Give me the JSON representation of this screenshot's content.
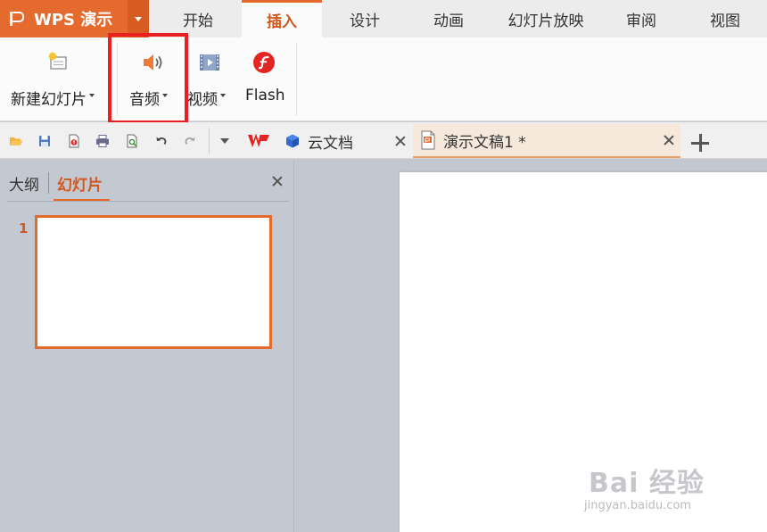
{
  "app": {
    "name": "WPS 演示"
  },
  "tabs": [
    "开始",
    "插入",
    "设计",
    "动画",
    "幻灯片放映",
    "审阅",
    "视图"
  ],
  "active_tab": "插入",
  "ribbon": {
    "new_slide": "新建幻灯片",
    "audio": "音频",
    "video": "视频",
    "flash": "Flash"
  },
  "doc_tabs": {
    "cloud": "云文档",
    "current": "演示文稿1 *"
  },
  "panel": {
    "outline_tab": "大纲",
    "slides_tab": "幻灯片",
    "slide_number": "1"
  },
  "watermark": {
    "main": "Bai 经验",
    "sub": "jingyan.baidu.com"
  },
  "colors": {
    "accent": "#e46a2d",
    "highlight_box": "#e9201f"
  },
  "icons": [
    "new-slide-icon",
    "audio-speaker-icon",
    "video-icon",
    "flash-icon",
    "open-folder-icon",
    "save-icon",
    "export-pdf-icon",
    "print-icon",
    "print-preview-icon",
    "undo-icon",
    "redo-icon",
    "wps-logo-icon",
    "cloud-cube-icon",
    "presentation-file-icon"
  ]
}
